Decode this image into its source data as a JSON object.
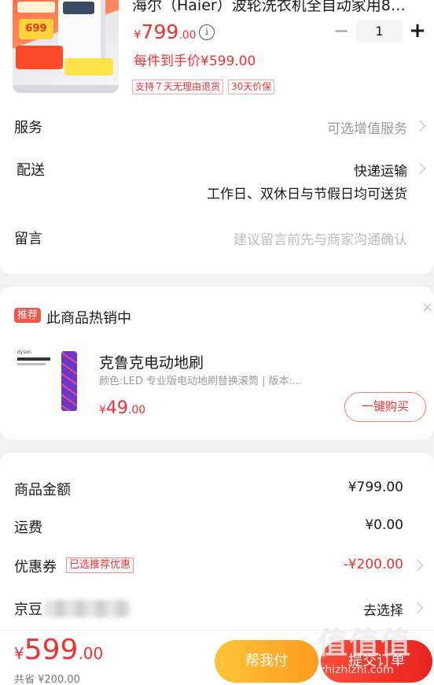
{
  "product": {
    "title": "海尔（Haier）波轮洗衣机全自动家用8公斤...",
    "price_currency": "¥",
    "price_int": "799",
    "price_dec": ".00",
    "info_icon": "i",
    "quantity": "1",
    "qty_minus": "−",
    "qty_plus": "+",
    "hand_price": "每件到手价¥599.00",
    "badges": [
      "支持７天无理由退货",
      "30天价保"
    ],
    "image_tag": "699"
  },
  "rows": {
    "service_label": "服务",
    "service_value": "可选增值服务",
    "delivery_label": "配送",
    "delivery_value": "快递运输",
    "delivery_note": "工作日、双休日与节假日均可送货",
    "note_label": "留言",
    "note_placeholder": "建议留言前先与商家沟通确认"
  },
  "recommend": {
    "badge": "推荐",
    "title": "此商品热销中",
    "close": "×",
    "brand": "dyson",
    "item_name": "克鲁克电动地刷",
    "item_spec": "颜色:LED 专业版电动地刷替换滚筒 | 版本:...",
    "price_currency": "¥",
    "price_int": "49",
    "price_dec": ".00",
    "buy_label": "一键购买"
  },
  "summary": {
    "goods_label": "商品金额",
    "goods_value": "¥799.00",
    "shipping_label": "运费",
    "shipping_value": "¥0.00",
    "coupon_label": "优惠券",
    "coupon_badge": "已选推荐优惠",
    "coupon_value": "-¥200.00",
    "jd_bean_label": "京豆",
    "jd_bean_value": "去选择"
  },
  "footer": {
    "total_currency": "¥",
    "total_int": "599",
    "total_dec": ".00",
    "saved": "共省 ¥200.00",
    "help_pay_label": "帮我付",
    "submit_label": "提交订单"
  },
  "watermark": {
    "big": "值值值",
    "url": "zhizhizhi.com"
  },
  "colors": {
    "accent_red": "#f23030",
    "help_orange": "#ffae2a",
    "pay_red": "#ee2e24"
  }
}
